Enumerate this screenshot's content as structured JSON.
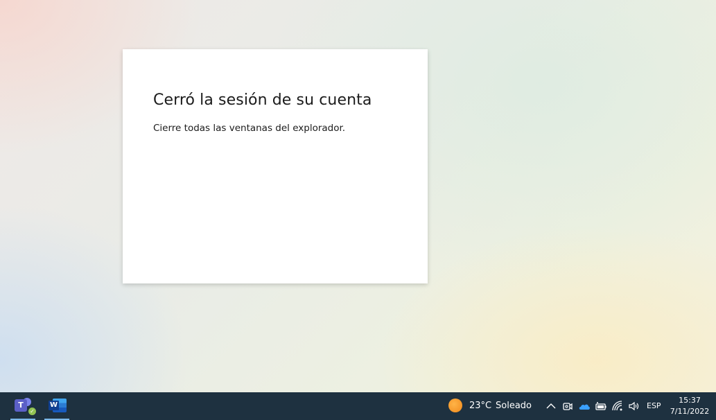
{
  "dialog": {
    "title": "Cerró la sesión de su cuenta",
    "message": "Cierre todas las ventanas del explorador."
  },
  "taskbar": {
    "apps": [
      {
        "name": "Microsoft Teams",
        "icon": "teams-icon",
        "glyph": "T"
      },
      {
        "name": "Microsoft Word",
        "icon": "word-icon",
        "glyph": "W"
      }
    ],
    "weather": {
      "temperature": "23°C",
      "condition": "Soleado",
      "icon": "sun-icon"
    },
    "tray_icons": [
      "chevron-up-icon",
      "meet-now-icon",
      "onedrive-icon",
      "battery-icon",
      "wifi-icon",
      "volume-icon"
    ],
    "language": "ESP",
    "time": "15:37",
    "date": "7/11/2022"
  },
  "colors": {
    "taskbar": "#1e3140",
    "dialog_bg": "#ffffff",
    "text": "#1b1b1b",
    "onedrive": "#3aa0ff",
    "teams": "#5b5fc7",
    "word": "#185abd"
  }
}
